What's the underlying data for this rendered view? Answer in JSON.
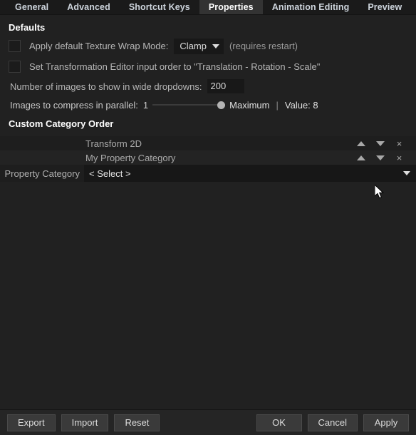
{
  "tabs": [
    {
      "label": "General",
      "active": false
    },
    {
      "label": "Advanced",
      "active": false
    },
    {
      "label": "Shortcut Keys",
      "active": false
    },
    {
      "label": "Properties",
      "active": true
    },
    {
      "label": "Animation Editing",
      "active": false
    },
    {
      "label": "Preview",
      "active": false
    }
  ],
  "defaults": {
    "title": "Defaults",
    "texture_wrap": {
      "label": "Apply default Texture Wrap Mode:",
      "value": "Clamp",
      "hint": "(requires restart)",
      "checked": false
    },
    "transformation_editor": {
      "label": "Set Transformation Editor input order to \"Translation - Rotation - Scale\"",
      "checked": false
    },
    "wide_dropdowns": {
      "label": "Number of images to show in wide dropdowns:",
      "value": "200"
    },
    "compress_parallel": {
      "label": "Images to compress in parallel:",
      "min_label": "1",
      "max_label": "Maximum",
      "separator": "|",
      "value_label": "Value: 8",
      "slider_percent": 100
    }
  },
  "custom_category_order": {
    "title": "Custom Category Order",
    "categories": [
      {
        "name": "Transform 2D"
      },
      {
        "name": "My Property Category"
      }
    ],
    "row_icons": {
      "move_up": "up-arrow-icon",
      "move_down": "down-arrow-icon",
      "remove": "×"
    },
    "add_row": {
      "label": "Property Category",
      "selected": "< Select >"
    }
  },
  "bottom_bar": {
    "export": "Export",
    "import": "Import",
    "reset": "Reset",
    "ok": "OK",
    "cancel": "Cancel",
    "apply": "Apply"
  },
  "colors": {
    "background": "#212121",
    "tabbar": "#1a1a1a",
    "active_tab": "#333333",
    "button": "#3a3a3a",
    "field": "#181818",
    "text": "#c8c8c8",
    "accent_text": "#ffffff"
  }
}
